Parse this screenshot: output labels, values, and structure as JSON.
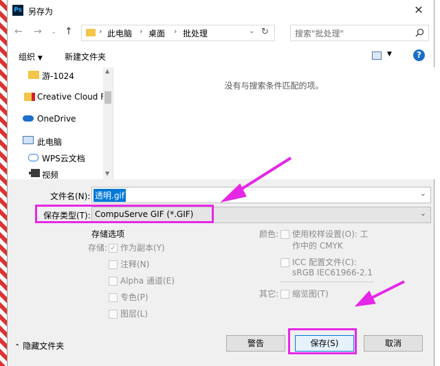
{
  "window": {
    "title": "另存为",
    "app_badge": "Ps"
  },
  "nav": {
    "breadcrumbs": [
      "此电脑",
      "桌面",
      "批处理"
    ],
    "search_placeholder": "搜索\"批处理\""
  },
  "toolbar": {
    "organize": "组织",
    "new_folder": "新建文件夹",
    "help": "?"
  },
  "sidebar": {
    "items": [
      {
        "label": "游-1024",
        "icon": "folder-icon"
      },
      {
        "label": "Creative Cloud F",
        "icon": "creative-cloud-icon"
      },
      {
        "label": "OneDrive",
        "icon": "onedrive-icon"
      },
      {
        "label": "此电脑",
        "icon": "computer-icon"
      },
      {
        "label": "WPS云文档",
        "icon": "wps-cloud-icon"
      },
      {
        "label": "视频",
        "icon": "video-icon"
      }
    ]
  },
  "content": {
    "empty_message": "没有与搜索条件匹配的项。"
  },
  "form": {
    "filename_label": "文件名(N):",
    "filename_value": "透明.gif",
    "filetype_label": "保存类型(T):",
    "filetype_value": "CompuServe GIF (*.GIF)"
  },
  "options": {
    "title": "存储选项",
    "storage_label": "存储:",
    "as_copy": "作为副本(Y)",
    "notes": "注释(N)",
    "alpha": "Alpha 通道(E)",
    "spot": "专色(P)",
    "layers": "图层(L)",
    "color_label": "颜色:",
    "proof_line1": "使用校样设置(O): 工",
    "proof_line2": "作中的 CMYK",
    "icc_line1": "ICC 配置文件(C):",
    "icc_line2": "sRGB IEC61966-2.1",
    "other_label": "其它:",
    "thumbnail": "缩览图(T)"
  },
  "footer": {
    "hide_folders": "隐藏文件夹",
    "warning_button": "警告",
    "save_button": "保存(S)",
    "cancel_button": "取消"
  },
  "colors": {
    "highlight": "#e626e6",
    "selection": "#0078d7",
    "folder": "#f3c548"
  }
}
